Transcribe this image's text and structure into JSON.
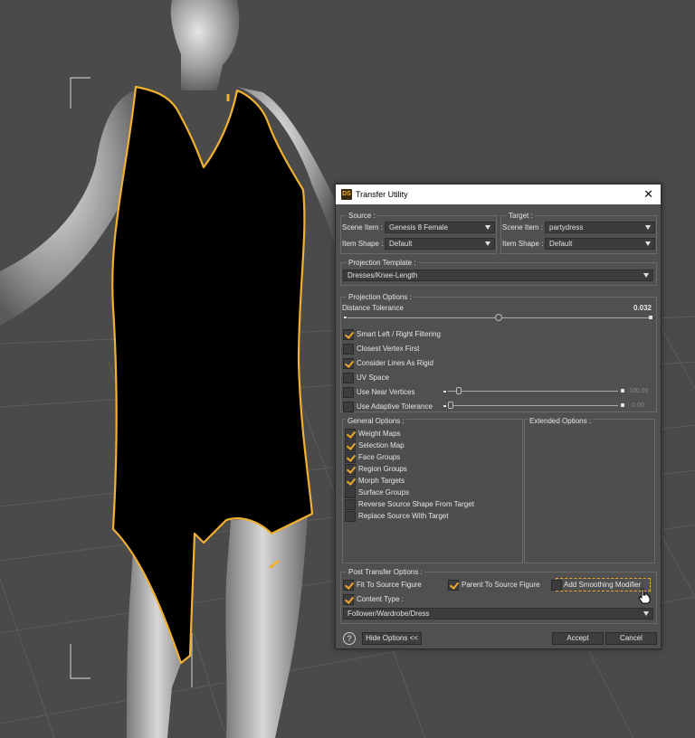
{
  "dialog": {
    "title": "Transfer Utility",
    "logo_text": "DS",
    "close_glyph": "✕",
    "source": {
      "legend": "Source :",
      "scene_item_label": "Scene Item :",
      "scene_item_value": "Genesis 8 Female",
      "item_shape_label": "Item Shape :",
      "item_shape_value": "Default"
    },
    "target": {
      "legend": "Target :",
      "scene_item_label": "Scene Item :",
      "scene_item_value": "partydress",
      "item_shape_label": "Item Shape :",
      "item_shape_value": "Default"
    },
    "projection_template": {
      "legend": "Projection Template :",
      "value": "Dresses/Knee-Length"
    },
    "projection_options": {
      "legend": "Projection Options :",
      "distance_label": "Distance Tolerance",
      "distance_value": "0.032",
      "distance_fraction": 0.5,
      "checks": [
        {
          "label": "Smart Left / Right Filtering",
          "checked": true
        },
        {
          "label": "Closest Vertex First",
          "checked": false
        },
        {
          "label": "Consider Lines As Rigid",
          "checked": true
        },
        {
          "label": "UV Space",
          "checked": false
        },
        {
          "label": "Use Near Vertices",
          "checked": false
        },
        {
          "label": "Use Adaptive Tolerance",
          "checked": false
        }
      ],
      "near_value": "100.00",
      "adaptive_value": "0.00"
    },
    "general_options": {
      "legend": "General Options :",
      "checks": [
        {
          "label": "Weight Maps",
          "checked": true
        },
        {
          "label": "Selection Map",
          "checked": true
        },
        {
          "label": "Face Groups",
          "checked": true
        },
        {
          "label": "Region Groups",
          "checked": true
        },
        {
          "label": "Morph Targets",
          "checked": true
        },
        {
          "label": "Surface Groups",
          "checked": false
        },
        {
          "label": "Reverse Source Shape From Target",
          "checked": false
        },
        {
          "label": "Replace Source With Target",
          "checked": false
        }
      ]
    },
    "extended_options": {
      "legend": "Extended Options :"
    },
    "post_transfer": {
      "legend": "Post Transfer Options :",
      "fit_to_source": {
        "label": "Fit To Source Figure",
        "checked": true
      },
      "parent_to_source": {
        "label": "Parent To Source Figure",
        "checked": true
      },
      "add_smoothing": {
        "label": "Add Smoothing Modifier",
        "checked": false
      },
      "content_type": {
        "label": "Content Type :",
        "checked": true
      },
      "content_value": "Follower/Wardrobe/Dress"
    },
    "footer": {
      "help_glyph": "?",
      "hide_options": "Hide Options <<",
      "accept": "Accept",
      "cancel": "Cancel"
    }
  },
  "colors": {
    "viewport_bg": "#4a4a4a",
    "selection_outline": "#f0b030",
    "checkmark": "#f0a82a",
    "dress": "#000000",
    "skin": "#b8b8b8"
  }
}
